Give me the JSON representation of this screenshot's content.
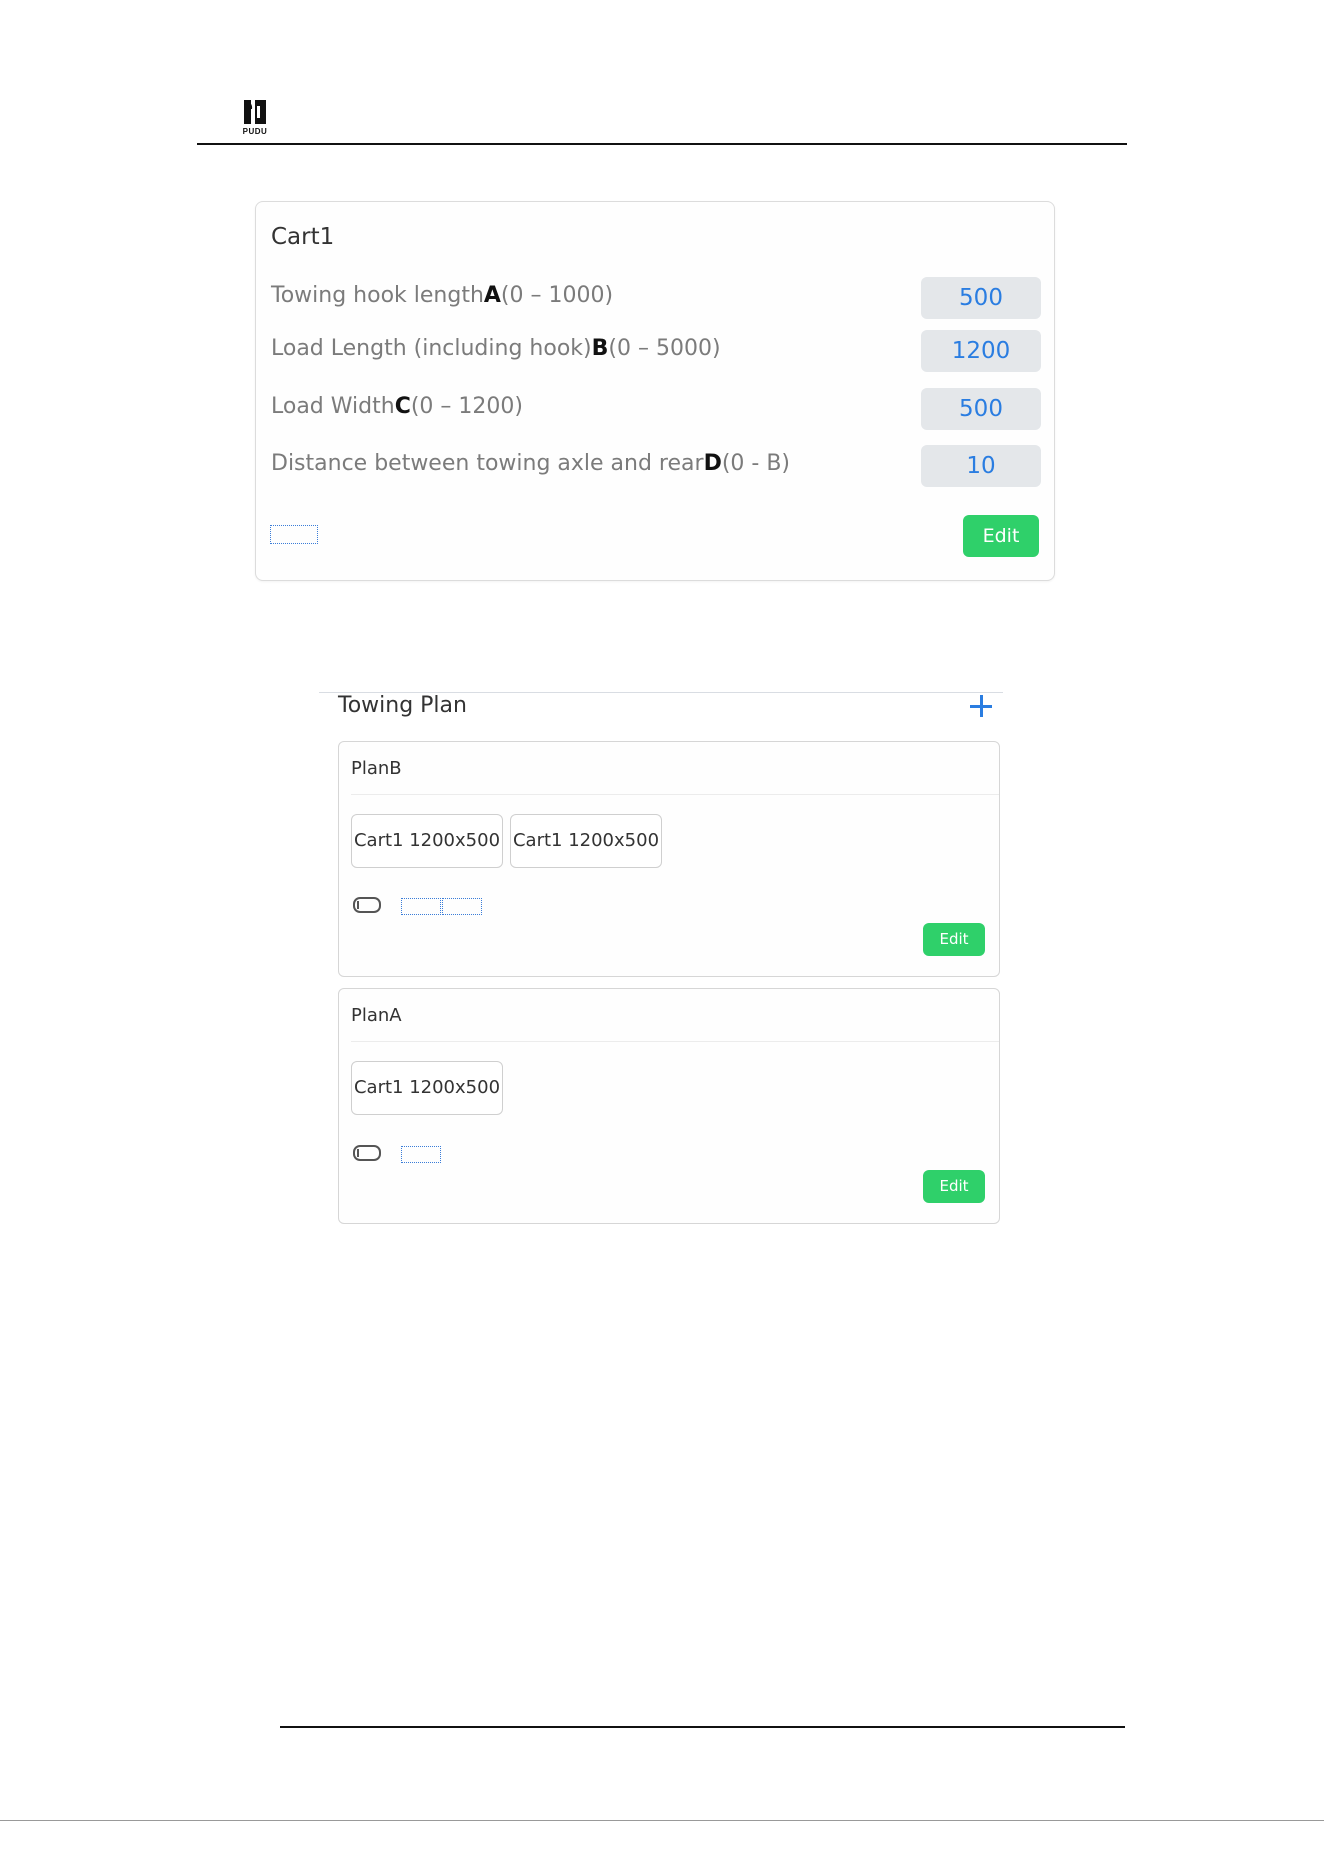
{
  "header": {
    "logo_text": "PUDU"
  },
  "cart": {
    "title": "Cart1",
    "params": [
      {
        "label": "Towing hook length",
        "letter": "A",
        "range": "(0 – 1000)",
        "value": "500"
      },
      {
        "label": "Load Length (including hook)",
        "letter": "B",
        "range": "(0 – 5000)",
        "value": "1200"
      },
      {
        "label": "Load Width",
        "letter": "C",
        "range": "(0 – 1200)",
        "value": "500"
      },
      {
        "label": "Distance between towing axle and rear",
        "letter": "D",
        "range": "(0 - B)",
        "value": "10"
      }
    ],
    "edit_label": "Edit"
  },
  "towing_plan": {
    "title": "Towing Plan",
    "add_icon": "plus-icon",
    "plans": [
      {
        "name": "PlanB",
        "carts": [
          "Cart1 1200x500",
          "Cart1 1200x500"
        ],
        "edit_label": "Edit"
      },
      {
        "name": "PlanA",
        "carts": [
          "Cart1 1200x500"
        ],
        "edit_label": "Edit"
      }
    ]
  },
  "colors": {
    "accent_blue": "#2a7de1",
    "edit_green": "#2fd06a",
    "value_bg": "#e4e7ea"
  }
}
